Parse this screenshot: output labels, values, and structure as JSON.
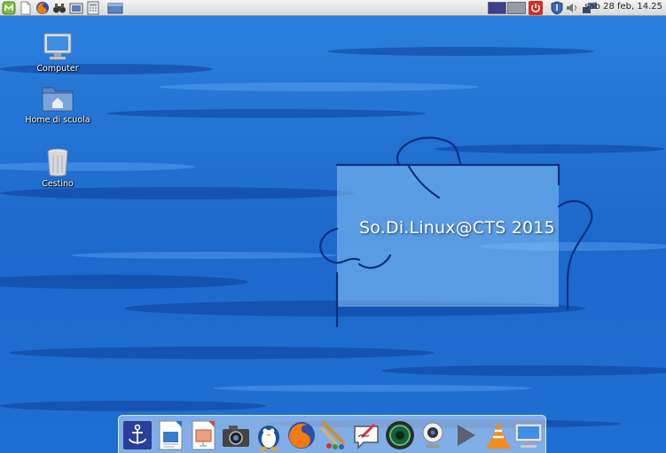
{
  "panel": {
    "clock": "sab 28 feb, 14.25",
    "launchers": [
      "menu-icon",
      "file-icon",
      "firefox-icon",
      "binoculars-icon",
      "screenshot-icon",
      "calculator-icon",
      "folder-window-icon"
    ],
    "workspaces": [
      "workspace-1",
      "workspace-2"
    ],
    "tray": [
      "power-icon",
      "shield-icon",
      "volume-icon",
      "network-icon"
    ]
  },
  "desktop": {
    "icons": [
      {
        "label": "Computer",
        "icon": "computer-icon"
      },
      {
        "label": "Home di scuola",
        "icon": "home-folder-icon"
      },
      {
        "label": "Cestino",
        "icon": "trash-icon"
      }
    ],
    "watermark": "So.Di.Linux@CTS 2015"
  },
  "dock": {
    "items": [
      "anchor-icon",
      "document-viewer-icon",
      "presentation-icon",
      "camera-icon",
      "linux-penguin-icon",
      "firefox-icon",
      "paint-brushes-icon",
      "drawing-board-icon",
      "webcam-lens-icon",
      "webcam-icon",
      "play-icon",
      "vlc-icon",
      "monitor-icon"
    ]
  },
  "colors": {
    "wallpaper": "#1f6fcf",
    "panel": "#e4e4e4",
    "workspace_active": "#3d3f8f"
  }
}
